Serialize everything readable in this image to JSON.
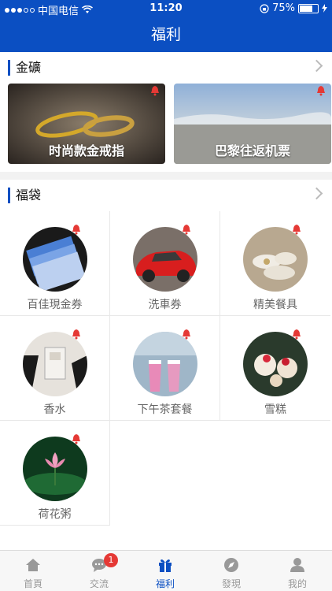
{
  "status_bar": {
    "carrier": "中国电信",
    "time": "11:20",
    "battery": "75%"
  },
  "nav": {
    "title": "福利"
  },
  "gold": {
    "title": "金礦",
    "cards": [
      {
        "label": "时尚款金戒指",
        "image": "gold-ring-photo"
      },
      {
        "label": "巴黎往返机票",
        "image": "sky-landscape-photo"
      }
    ]
  },
  "lucky_bag": {
    "title": "福袋",
    "items": [
      {
        "label": "百佳現金券",
        "image": "cash-voucher-photo"
      },
      {
        "label": "洗車券",
        "image": "red-car-photo"
      },
      {
        "label": "精美餐具",
        "image": "tableware-photo"
      },
      {
        "label": "香水",
        "image": "perfume-photo"
      },
      {
        "label": "下午茶套餐",
        "image": "afternoon-tea-photo"
      },
      {
        "label": "雪糕",
        "image": "ice-cream-photo"
      },
      {
        "label": "荷花粥",
        "image": "lotus-photo"
      }
    ]
  },
  "tabbar": {
    "tabs": [
      {
        "label": "首頁",
        "icon": "home-icon"
      },
      {
        "label": "交流",
        "icon": "chat-icon",
        "badge": "1"
      },
      {
        "label": "福利",
        "icon": "gift-icon"
      },
      {
        "label": "發現",
        "icon": "compass-icon"
      },
      {
        "label": "我的",
        "icon": "user-icon"
      }
    ]
  },
  "colors": {
    "primary": "#0b4fc2",
    "badge": "#e53935",
    "bell": "#e53935"
  }
}
